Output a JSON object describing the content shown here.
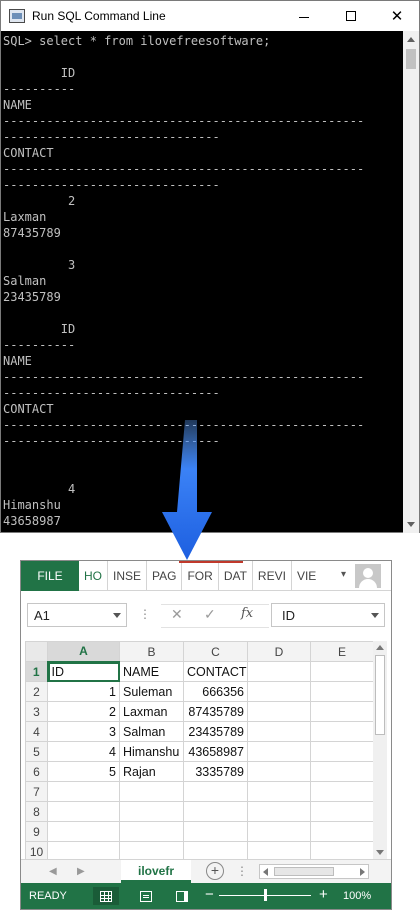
{
  "sql_window": {
    "title": "Run SQL Command Line",
    "minimize_label": "",
    "maximize_label": "",
    "close_label": "✕",
    "console_lines": [
      "SQL> select * from ilovefreesoftware;",
      "",
      "        ID",
      "----------",
      "NAME",
      "--------------------------------------------------",
      "------------------------------",
      "CONTACT",
      "--------------------------------------------------",
      "------------------------------",
      "         2",
      "Laxman",
      "87435789",
      "",
      "         3",
      "Salman",
      "23435789",
      "",
      "        ID",
      "----------",
      "NAME",
      "--------------------------------------------------",
      "------------------------------",
      "CONTACT",
      "--------------------------------------------------",
      "------------------------------",
      "",
      "",
      "         4",
      "Himanshu",
      "43658987"
    ]
  },
  "arrow": {
    "color": "#2f6fe8"
  },
  "excel": {
    "colors": {
      "accent": "#217346",
      "status_bar": "#217346"
    },
    "ribbon": {
      "file": "FILE",
      "tabs": [
        "HO",
        "INSE",
        "PAG",
        "FOR",
        "DAT",
        "REVI",
        "VIE"
      ],
      "more": "▾"
    },
    "formula_bar": {
      "name_box": "A1",
      "dots": "⋮",
      "cancel": "✕",
      "enter": "✓",
      "fx": "fx",
      "formula": "ID"
    },
    "grid": {
      "columns": [
        "A",
        "B",
        "C",
        "D",
        "E"
      ],
      "rows": [
        {
          "num": "1",
          "cells": [
            "ID",
            "NAME",
            "CONTACT",
            "",
            ""
          ]
        },
        {
          "num": "2",
          "cells": [
            "1",
            "Suleman",
            "666356",
            "",
            ""
          ]
        },
        {
          "num": "3",
          "cells": [
            "2",
            "Laxman",
            "87435789",
            "",
            ""
          ]
        },
        {
          "num": "4",
          "cells": [
            "3",
            "Salman",
            "23435789",
            "",
            ""
          ]
        },
        {
          "num": "5",
          "cells": [
            "4",
            "Himanshu",
            "43658987",
            "",
            ""
          ]
        },
        {
          "num": "6",
          "cells": [
            "5",
            "Rajan",
            "3335789",
            "",
            ""
          ]
        },
        {
          "num": "7",
          "cells": [
            "",
            "",
            "",
            "",
            ""
          ]
        },
        {
          "num": "8",
          "cells": [
            "",
            "",
            "",
            "",
            ""
          ]
        },
        {
          "num": "9",
          "cells": [
            "",
            "",
            "",
            "",
            ""
          ]
        },
        {
          "num": "10",
          "cells": [
            "",
            "",
            "",
            "",
            ""
          ]
        }
      ]
    },
    "sheet_bar": {
      "prev": "◀",
      "next": "▶",
      "sheet_tab": "ilovefr",
      "add": "+",
      "more": "⋮"
    },
    "status_bar": {
      "ready": "READY",
      "zoom_minus": "−",
      "zoom_plus": "+",
      "zoom": "100%",
      "zoom_level_percent": 100
    }
  }
}
